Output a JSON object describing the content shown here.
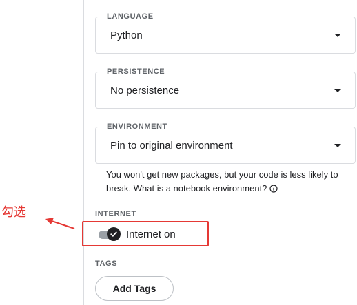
{
  "settings": {
    "language": {
      "label": "LANGUAGE",
      "value": "Python"
    },
    "persistence": {
      "label": "PERSISTENCE",
      "value": "No persistence"
    },
    "environment": {
      "label": "ENVIRONMENT",
      "value": "Pin to original environment",
      "helper_text": "You won't get new packages, but your code is less likely to break. What is a notebook environment?"
    },
    "internet": {
      "label": "INTERNET",
      "toggle_label": "Internet on",
      "enabled": true
    },
    "tags": {
      "label": "TAGS",
      "button_label": "Add Tags"
    }
  },
  "annotation": {
    "text": "勾选",
    "color": "#e53935"
  },
  "icons": {
    "dropdown": "caret-down-icon",
    "info": "info-icon",
    "toggle_check": "check-icon"
  }
}
